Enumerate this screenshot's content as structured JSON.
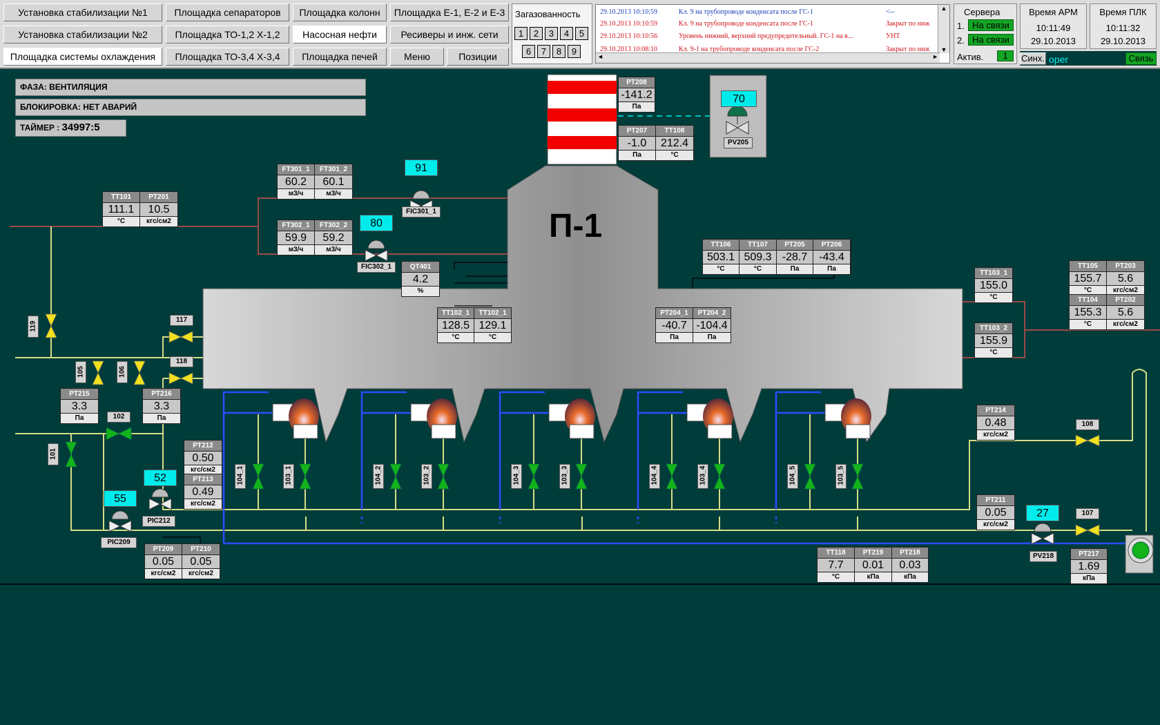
{
  "nav": {
    "row1": [
      "Установка стабилизации №1",
      "Площадка сепараторов",
      "Площадка колонн",
      "Площадка Е-1, Е-2 и Е-3"
    ],
    "row2": [
      "Установка стабилизации №2",
      "Площадка ТО-1,2 Х-1,2",
      "Насосная нефти",
      "Ресиверы и инж. сети"
    ],
    "row3": [
      "Площадка системы охлаждения",
      "Площадка ТО-3,4 Х-3,4",
      "Площадка печей",
      "Меню",
      "Позиции"
    ]
  },
  "gas": {
    "label": "Загазованность",
    "buttons": [
      "1",
      "2",
      "3",
      "4",
      "5",
      "6",
      "7",
      "8",
      "9"
    ]
  },
  "alarms": [
    {
      "time": "29.10.2013 10:10:59",
      "msg": "Кл. 9 на трубопроводе конденсата после ГС-1",
      "state": "<--",
      "color": "#1a3fb5"
    },
    {
      "time": "29.10.2013 10:10:59",
      "msg": "Кл. 9 на трубопроводе конденсата после ГС-1",
      "state": "Закрыт по ниж",
      "color": "#d0141a"
    },
    {
      "time": "29.10.2013 10:10:56",
      "msg": "Уровень нижний, верхний предупредительный. ГС-1 на в...",
      "state": "УНТ",
      "color": "#d0141a"
    },
    {
      "time": "29.10.2013 10:08:10",
      "msg": "Кл. 9-1 на трубопроводе конденсата после ГС-2",
      "state": "Закрыт по ниж",
      "color": "#d0141a"
    }
  ],
  "servers": {
    "title": "Сервера",
    "s1_label": "1.",
    "s1_status": "На связи",
    "s2_label": "2.",
    "s2_status": "На связи",
    "active_label": "Актив.",
    "active_value": "1"
  },
  "time_arm": {
    "label": "Время АРМ",
    "time": "10:11:49",
    "date": "29.10.2013"
  },
  "time_plc": {
    "label": "Время ПЛК",
    "time": "10:11:32",
    "date": "29.10.2013"
  },
  "sync": {
    "label": "Синх.",
    "user": "oper",
    "link": "Связь"
  },
  "status": {
    "phase": "ФАЗА: ВЕНТИЛЯЦИЯ",
    "block": "БЛОКИРОВКА: НЕТ АВАРИЙ",
    "timer_label": "ТАЙМЕР :",
    "timer_value": "34997:5"
  },
  "title": "П-1",
  "colors": {
    "bg": "#003c3a",
    "pipe_yellow": "#d7de86",
    "pipe_red": "#9a4a4a",
    "pipe_blue": "#2b4cff",
    "valve_green": "#13b31b",
    "valve_yellow": "#f0e020",
    "cyan": "#00ecec"
  },
  "readouts": {
    "PT208": {
      "tag": "PT208",
      "val": "-141.2",
      "unit": "Па"
    },
    "PT207": {
      "tag": "PT207",
      "val": "-1.0",
      "unit": "Па"
    },
    "TT108": {
      "tag": "TT108",
      "val": "212.4",
      "unit": "°C"
    },
    "FT301_1": {
      "tag": "FT301_1",
      "val": "60.2",
      "unit": "м3/ч"
    },
    "FT301_2": {
      "tag": "FT301_2",
      "val": "60.1",
      "unit": "м3/ч"
    },
    "FT302_1": {
      "tag": "FT302_1",
      "val": "59.9",
      "unit": "м3/ч"
    },
    "FT302_2": {
      "tag": "FT302_2",
      "val": "59.2",
      "unit": "м3/ч"
    },
    "TT101": {
      "tag": "TT101",
      "val": "111.1",
      "unit": "°C"
    },
    "PT201": {
      "tag": "PT201",
      "val": "10.5",
      "unit": "кгс/см2"
    },
    "QT401": {
      "tag": "QT401",
      "val": "4.2",
      "unit": "%"
    },
    "TT106": {
      "tag": "TT106",
      "val": "503.1",
      "unit": "°C"
    },
    "TT107": {
      "tag": "TT107",
      "val": "509.3",
      "unit": "°C"
    },
    "PT205": {
      "tag": "PT205",
      "val": "-28.7",
      "unit": "Па"
    },
    "PT206": {
      "tag": "PT206",
      "val": "-43.4",
      "unit": "Па"
    },
    "TT102_1a": {
      "tag": "TT102_1",
      "val": "128.5",
      "unit": "°C"
    },
    "TT102_1b": {
      "tag": "TT102_1",
      "val": "129.1",
      "unit": "°C"
    },
    "PT204_1": {
      "tag": "PT204_1",
      "val": "-40.7",
      "unit": "Па"
    },
    "PT204_2": {
      "tag": "PT204_2",
      "val": "-104.4",
      "unit": "Па"
    },
    "TT103_1": {
      "tag": "TT103_1",
      "val": "155.0",
      "unit": "°C"
    },
    "TT103_2": {
      "tag": "TT103_2",
      "val": "155.9",
      "unit": "°C"
    },
    "TT105": {
      "tag": "TT105",
      "val": "155.7",
      "unit": "°C"
    },
    "PT203": {
      "tag": "PT203",
      "val": "5.6",
      "unit": "кгс/см2"
    },
    "TT104": {
      "tag": "TT104",
      "val": "155.3",
      "unit": "°C"
    },
    "PT202": {
      "tag": "PT202",
      "val": "5.6",
      "unit": "кгс/см2"
    },
    "PT215": {
      "tag": "PT215",
      "val": "3.3",
      "unit": "Па"
    },
    "PT216": {
      "tag": "PT216",
      "val": "3.3",
      "unit": "Па"
    },
    "PT212": {
      "tag": "PT212",
      "val": "0.50",
      "unit": "кгс/см2"
    },
    "PT213": {
      "tag": "PT213",
      "val": "0.49",
      "unit": "кгс/см2"
    },
    "PT209": {
      "tag": "PT209",
      "val": "0.05",
      "unit": "кгс/см2"
    },
    "PT210": {
      "tag": "PT210",
      "val": "0.05",
      "unit": "кгс/см2"
    },
    "PT214": {
      "tag": "PT214",
      "val": "0.48",
      "unit": "кгс/см2"
    },
    "PT211": {
      "tag": "PT211",
      "val": "0.05",
      "unit": "кгс/см2"
    },
    "TT118": {
      "tag": "TT118",
      "val": "7.7",
      "unit": "°C"
    },
    "PT219": {
      "tag": "PT219",
      "val": "0.01",
      "unit": "кПа"
    },
    "PT218": {
      "tag": "PT218",
      "val": "0.03",
      "unit": "кПа"
    },
    "PT217": {
      "tag": "PT217",
      "val": "1.69",
      "unit": "кПа"
    }
  },
  "positions": {
    "PV205": "70",
    "FIC301": "91",
    "FIC302": "80",
    "PIC212": "52",
    "PIC209": "55",
    "PV218": "27"
  },
  "tags": {
    "PV205": "PV205",
    "FIC301": "FIC301_1",
    "FIC302": "FIC302_1",
    "PIC212": "PIC212",
    "PIC209": "PIC209",
    "PV218": "PV218",
    "v117": "117",
    "v118": "118",
    "v102": "102",
    "v108": "108",
    "v107": "107",
    "v119": "119",
    "v105": "105",
    "v106": "106",
    "v101": "101",
    "b104_1": "104_1",
    "b103_1": "103_1",
    "b104_2": "104_2",
    "b103_2": "103_2",
    "b104_3": "104_3",
    "b103_3": "103_3",
    "b104_4": "104_4",
    "b103_4": "103_4",
    "b104_5": "104_5",
    "b103_5": "103_5"
  }
}
